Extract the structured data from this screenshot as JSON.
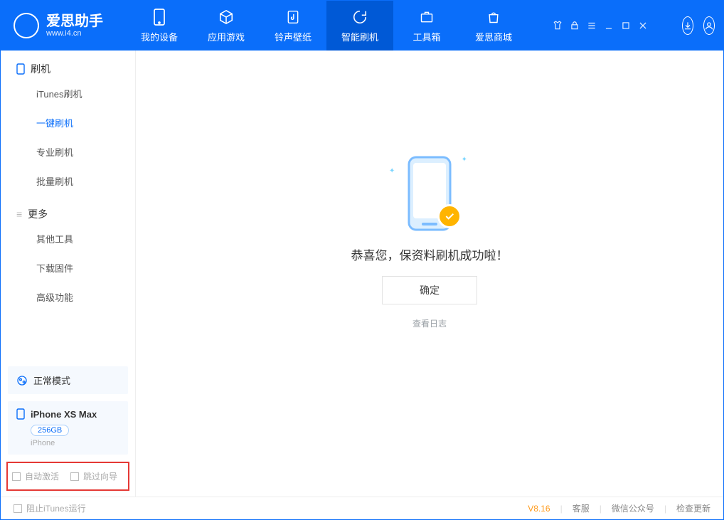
{
  "brand": {
    "name": "爱思助手",
    "url": "www.i4.cn"
  },
  "tabs": {
    "device": "我的设备",
    "apps": "应用游戏",
    "ringtone": "铃声壁纸",
    "flash": "智能刷机",
    "toolbox": "工具箱",
    "store": "爱思商城"
  },
  "sidebar": {
    "group_flash": "刷机",
    "items_flash": {
      "itunes": "iTunes刷机",
      "onekey": "一键刷机",
      "pro": "专业刷机",
      "batch": "批量刷机"
    },
    "group_more": "更多",
    "items_more": {
      "other": "其他工具",
      "download": "下载固件",
      "advanced": "高级功能"
    },
    "mode": "正常模式",
    "device_name": "iPhone XS Max",
    "capacity": "256GB",
    "device_type": "iPhone",
    "auto_activate": "自动激活",
    "skip_guide": "跳过向导"
  },
  "main": {
    "message": "恭喜您，保资料刷机成功啦！",
    "confirm": "确定",
    "view_log": "查看日志"
  },
  "footer": {
    "block_itunes": "阻止iTunes运行",
    "version": "V8.16",
    "support": "客服",
    "wechat": "微信公众号",
    "check_update": "检查更新"
  }
}
